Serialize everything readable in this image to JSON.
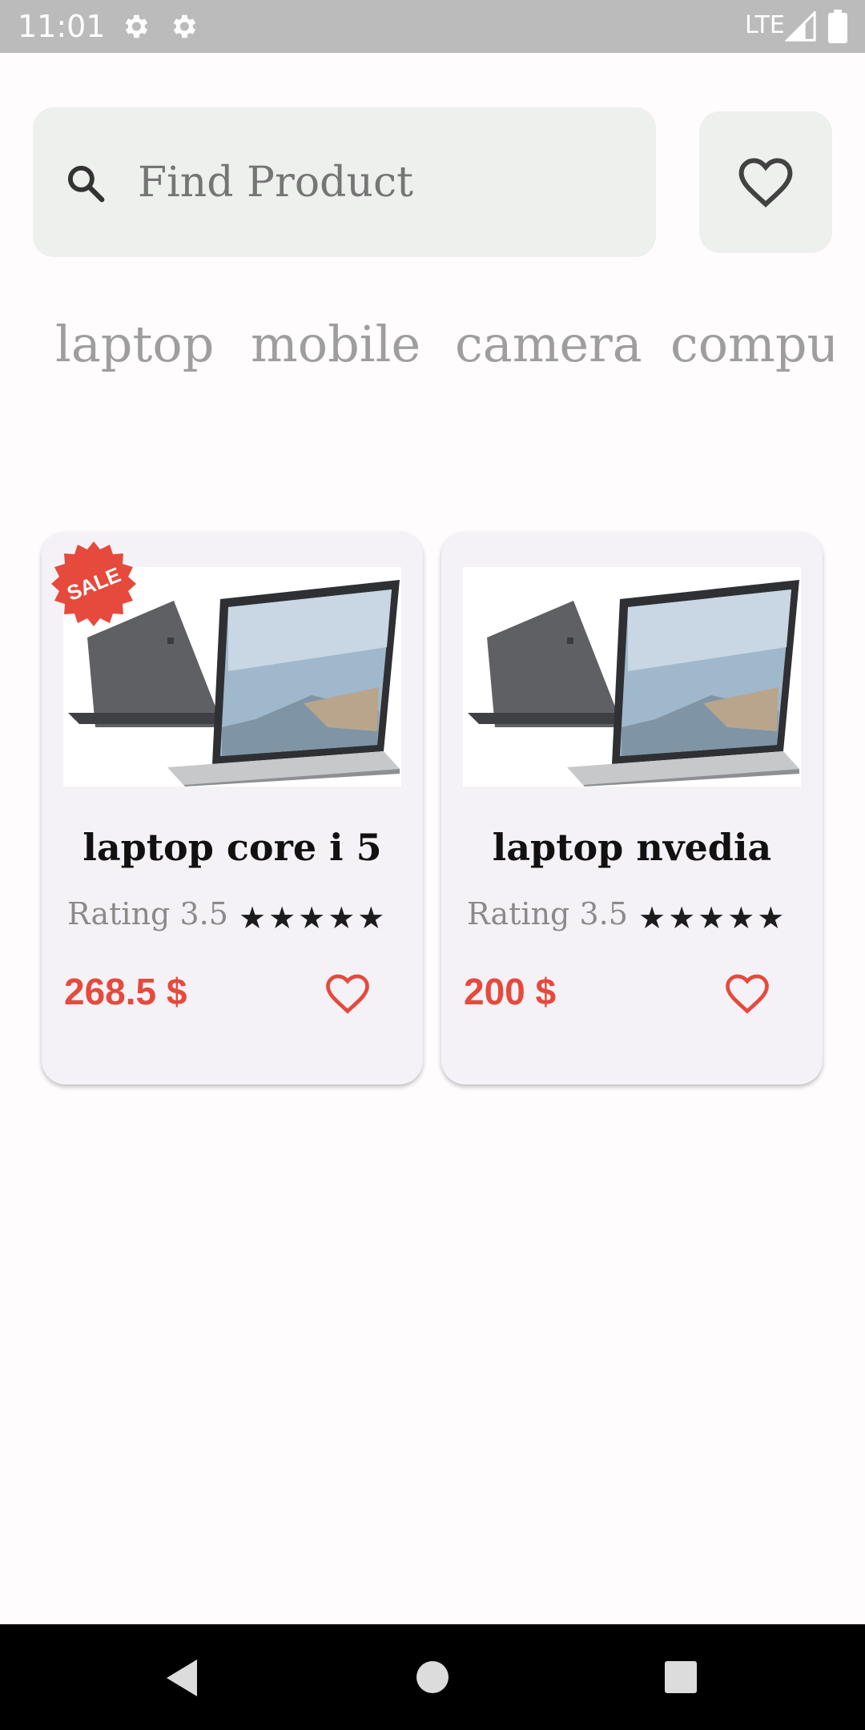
{
  "status_bar": {
    "time": "11:01",
    "network": "LTE",
    "icons": [
      "gear-icon",
      "gear-icon",
      "signal-icon",
      "battery-icon"
    ]
  },
  "search": {
    "placeholder": "Find Product",
    "icon": "search-icon"
  },
  "favorites_button": {
    "icon": "heart-outline-icon"
  },
  "categories": [
    "laptop",
    "mobile",
    "camera",
    "computer"
  ],
  "products": [
    {
      "name": "laptop core i 5",
      "rating_text": "Rating 3.5",
      "rating": 3.5,
      "stars": "★★★★★",
      "price": "268.5 $",
      "badge": "SALE",
      "image": "laptop-image"
    },
    {
      "name": "laptop nvedia",
      "rating_text": "Rating 3.5",
      "rating": 3.5,
      "stars": "★★★★★",
      "price": "200 $",
      "image": "laptop-image"
    }
  ],
  "nav_bar": {
    "icons": [
      "back-icon",
      "home-icon",
      "recents-icon"
    ]
  },
  "colors": {
    "accent": "#e54a3c",
    "search_bg": "#eef0ee",
    "card_bg": "#f5f2f7",
    "status_bar": "#bbbbbb"
  }
}
